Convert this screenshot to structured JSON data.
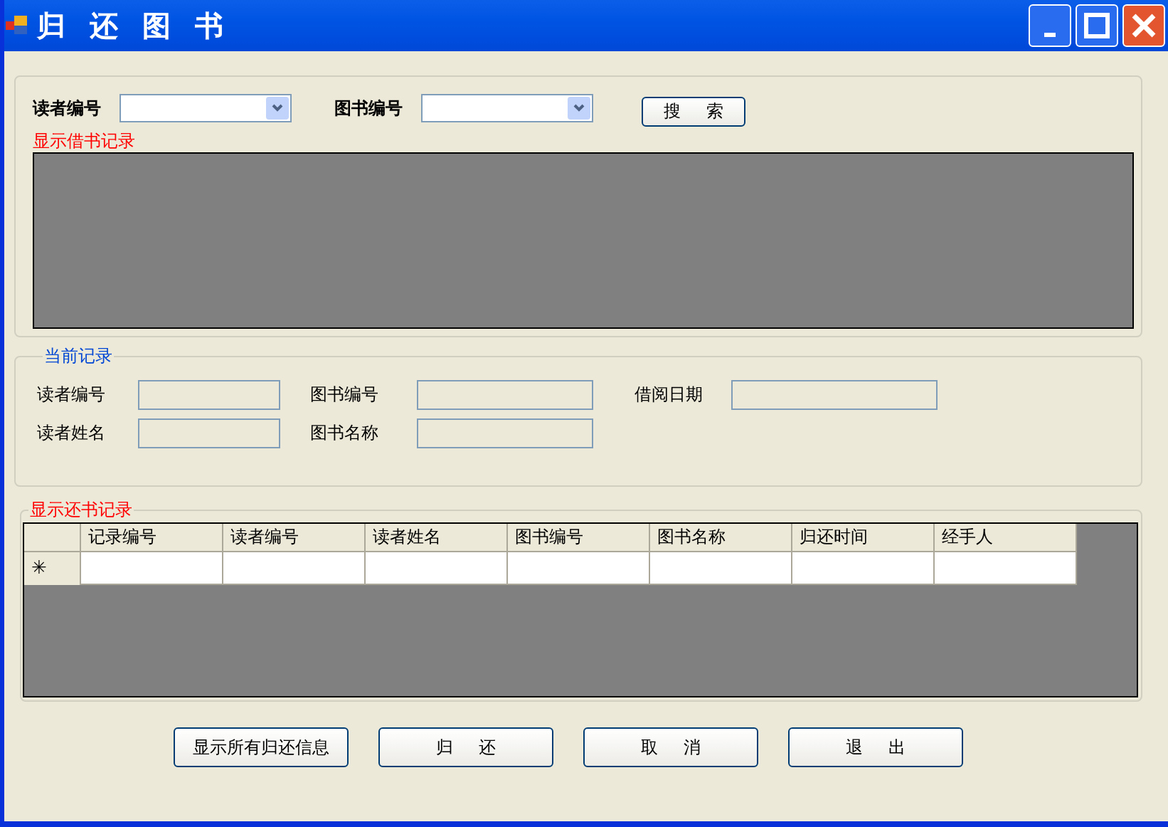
{
  "window": {
    "title": "归 还 图 书"
  },
  "search": {
    "fields": [
      {
        "label": "读者编号"
      },
      {
        "label": "图书编号"
      }
    ],
    "button": "搜 索",
    "caption": "显示借书记录"
  },
  "current_record": {
    "title": "当前记录",
    "rows": [
      [
        {
          "label": "读者编号"
        },
        {
          "label": "图书编号"
        },
        {
          "label": "借阅日期"
        }
      ],
      [
        {
          "label": "读者姓名"
        },
        {
          "label": "图书名称"
        }
      ]
    ]
  },
  "returns": {
    "title": "显示还书记录",
    "columns": [
      "记录编号",
      "读者编号",
      "读者姓名",
      "图书编号",
      "图书名称",
      "归还时间",
      "经手人"
    ],
    "new_row_marker": "✳"
  },
  "buttons": [
    "显示所有归还信息",
    "归 还",
    "取 消",
    "退 出"
  ]
}
